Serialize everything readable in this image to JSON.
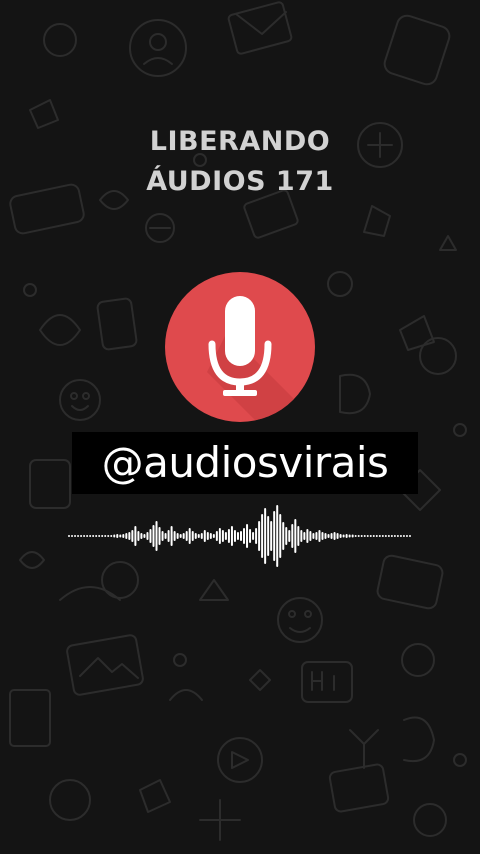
{
  "title": {
    "line1": "LIBERANDO",
    "line2": "ÁUDIOS 171"
  },
  "handle": "@audiosvirais",
  "colors": {
    "background": "#141414",
    "mic_circle": "#df4a4d",
    "title_text": "#d2d2d2",
    "handle_box": "#000000",
    "waveform": "#ffffff"
  },
  "icons": {
    "mic": "microphone-icon",
    "waveform": "audio-waveform-icon"
  }
}
